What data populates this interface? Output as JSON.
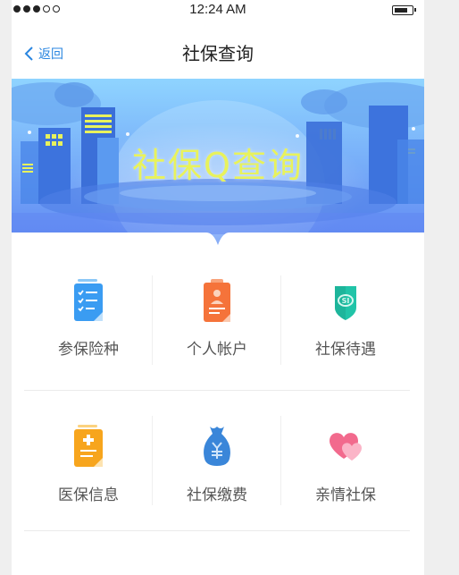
{
  "status_bar": {
    "time": "12:24 AM",
    "signal_dots_filled": 3,
    "signal_dots_total": 5
  },
  "nav": {
    "back_label": "返回",
    "title": "社保查询"
  },
  "banner": {
    "title": "社保Q查询"
  },
  "menu": [
    {
      "label": "参保险种",
      "icon": "insurance-type-icon",
      "color": "#3a9cf2"
    },
    {
      "label": "个人帐户",
      "icon": "personal-account-icon",
      "color": "#f5733a"
    },
    {
      "label": "社保待遇",
      "icon": "social-security-benefit-icon",
      "color": "#21c4a8"
    },
    {
      "label": "医保信息",
      "icon": "medical-insurance-icon",
      "color": "#f7a51d"
    },
    {
      "label": "社保缴费",
      "icon": "payment-money-bag-icon",
      "color": "#3a86d9"
    },
    {
      "label": "亲情社保",
      "icon": "family-hearts-icon",
      "color": "#f26a8d"
    }
  ],
  "colors": {
    "accent": "#2a86e0",
    "banner_top": "#8fd4ff",
    "banner_bottom": "#5f86f2",
    "banner_text": "#e8f25c"
  }
}
